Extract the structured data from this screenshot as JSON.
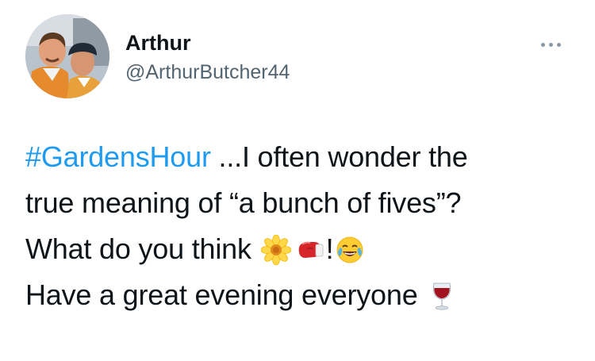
{
  "user": {
    "name": "Arthur",
    "handle": "@ArthurButcher44"
  },
  "more_menu_icon": "ellipsis-icon",
  "tweet": {
    "hashtag": "#GardensHour",
    "line1_rest": " ...I often wonder the",
    "line2": "true meaning of “a bunch of fives”?",
    "line3_text": "What do you think ",
    "line3_exclaim": "!",
    "line4_text": "Have a great evening everyone ",
    "emojis": {
      "flower": "sunflower-emoji",
      "glove": "boxing-glove-emoji",
      "laugh": "face-with-tears-of-joy-emoji",
      "wine": "wine-glass-emoji"
    }
  },
  "colors": {
    "hashtag": "#1d9bf0",
    "text": "#0f1419",
    "secondary": "#536471"
  }
}
